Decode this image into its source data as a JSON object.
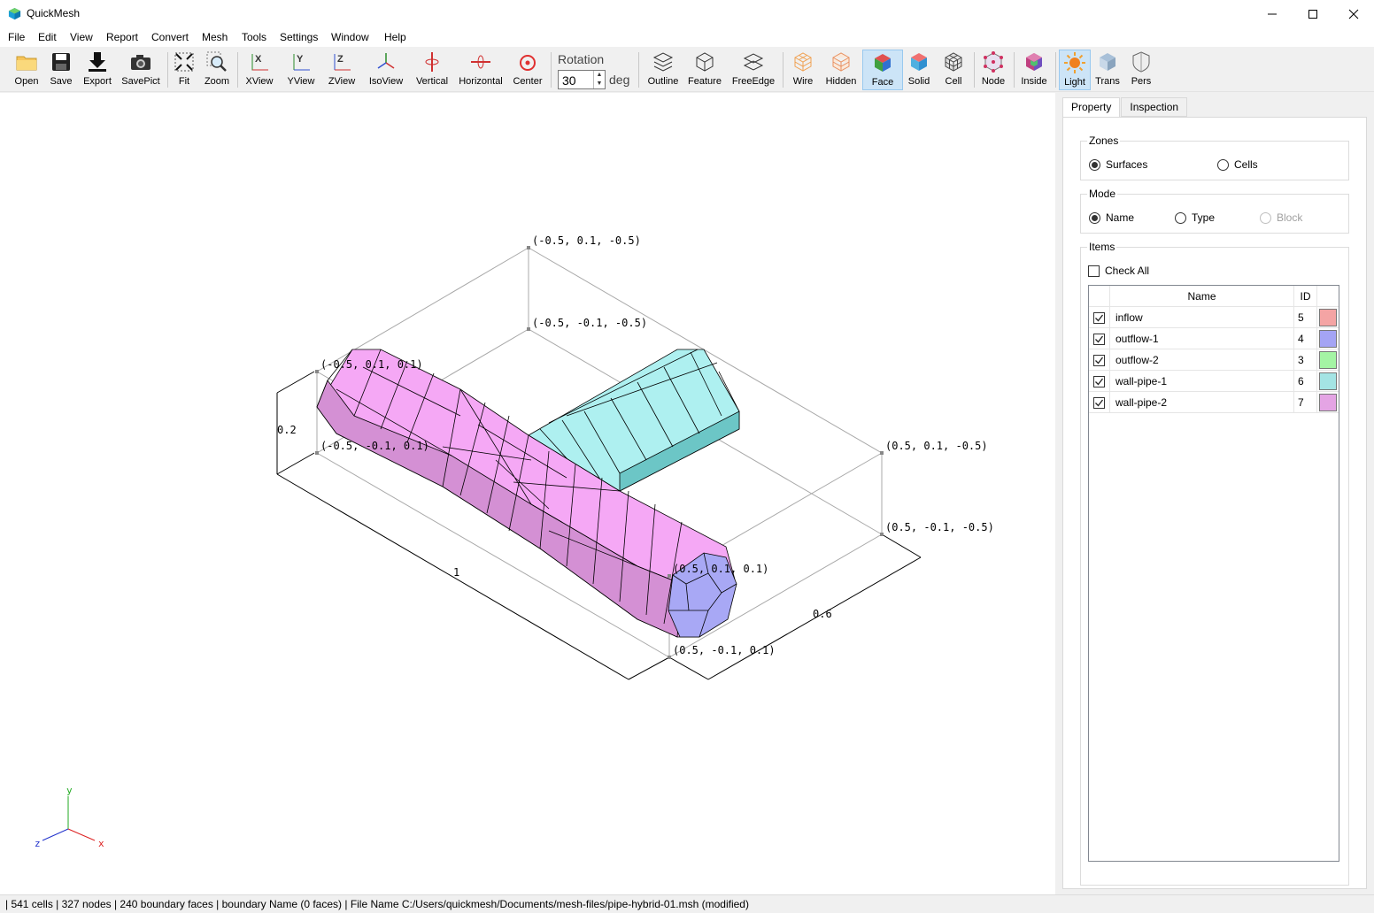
{
  "window": {
    "title": "QuickMesh",
    "minimize": "—",
    "maximize": "☐",
    "close": "✕"
  },
  "menu": [
    "File",
    "Edit",
    "View",
    "Report",
    "Convert",
    "Mesh",
    "Tools",
    "Settings",
    "Window",
    "Help"
  ],
  "toolbar": {
    "open": "Open",
    "save": "Save",
    "export": "Export",
    "savepict": "SavePict",
    "fit": "Fit",
    "zoom": "Zoom",
    "xview": "XView",
    "yview": "YView",
    "zview": "ZView",
    "isoview": "IsoView",
    "vertical": "Vertical",
    "horizontal": "Horizontal",
    "center": "Center",
    "rotation_label": "Rotation",
    "rotation_value": "30",
    "rotation_unit": "deg",
    "outline": "Outline",
    "feature": "Feature",
    "freeedge": "FreeEdge",
    "wire": "Wire",
    "hidden": "Hidden",
    "face": "Face",
    "solid": "Solid",
    "cell": "Cell",
    "node": "Node",
    "inside": "Inside",
    "light": "Light",
    "trans": "Trans",
    "pers": "Pers"
  },
  "viewport": {
    "labels": {
      "c1": "(-0.5, 0.1, -0.5)",
      "c2": "(-0.5, -0.1, -0.5)",
      "c3": "(-0.5, 0.1, 0.1)",
      "c4": "(-0.5, -0.1, 0.1)",
      "c5": "(0.5, 0.1, -0.5)",
      "c6": "(0.5, -0.1, -0.5)",
      "c7": "(0.5, 0.1, 0.1)",
      "c8": "(0.5, -0.1, 0.1)"
    },
    "dims": {
      "height": "0.2",
      "length": "1",
      "depth": "0.6"
    },
    "axes": {
      "x": "x",
      "y": "y",
      "z": "z"
    }
  },
  "panel": {
    "tabs": [
      "Property",
      "Inspection"
    ],
    "zones": {
      "title": "Zones",
      "surfaces": "Surfaces",
      "cells": "Cells"
    },
    "mode": {
      "title": "Mode",
      "name": "Name",
      "type": "Type",
      "block": "Block"
    },
    "items": {
      "title": "Items",
      "check_all": "Check All",
      "col_name": "Name",
      "col_id": "ID",
      "rows": [
        {
          "name": "inflow",
          "id": "5",
          "color": "#f4a4a4"
        },
        {
          "name": "outflow-1",
          "id": "4",
          "color": "#a4a4f4"
        },
        {
          "name": "outflow-2",
          "id": "3",
          "color": "#a4f4a4"
        },
        {
          "name": "wall-pipe-1",
          "id": "6",
          "color": "#a4e4e4"
        },
        {
          "name": "wall-pipe-2",
          "id": "7",
          "color": "#e4a4e4"
        }
      ]
    }
  },
  "status": "| 541 cells | 327 nodes | 240 boundary faces |  boundary Name  (0 faces) | File Name C:/Users/quickmesh/Documents/mesh-files/pipe-hybrid-01.msh (modified)"
}
